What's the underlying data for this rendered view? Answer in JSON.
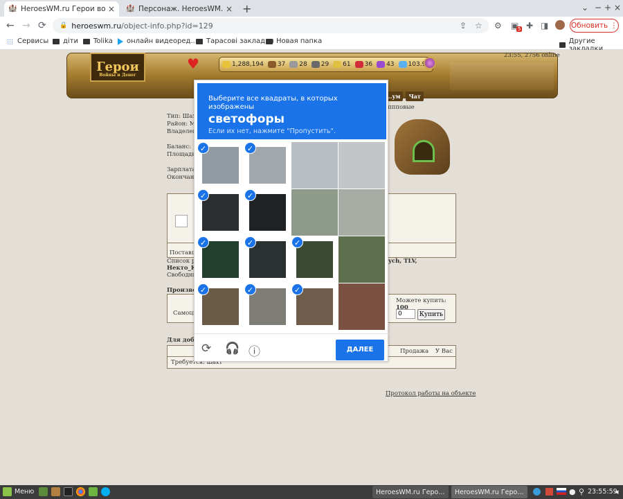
{
  "browser": {
    "tabs": [
      {
        "title": "HeroesWM.ru Герои войны и ...",
        "active": true
      },
      {
        "title": "Персонаж. HeroesWM.ru Геро",
        "active": false
      }
    ],
    "new_tab": "+",
    "url_host": "heroeswm.ru",
    "url_path": "/object-info.php?id=129",
    "update_label": "Обновить",
    "ext_badge": "5",
    "win_controls": [
      "⌄",
      "−",
      "+",
      "×"
    ]
  },
  "bookmarks": {
    "items": [
      "Сервисы",
      "діти",
      "Tolika",
      "онлайн видеоред...",
      "Тарасові закладки",
      "Новая папка"
    ],
    "other": "Другие закладки"
  },
  "game": {
    "logo": "Герои",
    "logo_sub": "Войны и Денег",
    "clock": "23:55, 2756 online",
    "resources": [
      {
        "value": "1,288,194",
        "color": "#e8c33a"
      },
      {
        "value": "37",
        "color": "#8a5a2a"
      },
      {
        "value": "28",
        "color": "#9a9a9a"
      },
      {
        "value": "29",
        "color": "#6a6a6a"
      },
      {
        "value": "61",
        "color": "#e0c040"
      },
      {
        "value": "36",
        "color": "#d02c3c"
      },
      {
        "value": "43",
        "color": "#9a4ad0"
      },
      {
        "value": "103.9",
        "color": "#5ab0f0"
      }
    ],
    "menu": [
      "...ум",
      "Чат"
    ],
    "menu_extra": "ппповые",
    "info_lines": [
      "Тип: Шахт",
      "Район: Mi",
      "Владелец:",
      "",
      "Баланс:",
      "Площадь:",
      "",
      "Зарплата:",
      "Окончани"
    ],
    "suppliers_label": "Поставщ",
    "list_label": "Список ра",
    "list_names": "ych, TLV,",
    "name_bold": "Некто_К",
    "free_label": "Свободны",
    "production_label": "Производ",
    "self_label": "Самоцв",
    "can_buy_label": "Можете купить:",
    "can_buy_value": "100",
    "qty_value": "0",
    "buy_label": "Купить",
    "forgood_label": "Для добы",
    "sale_label": "Продажа",
    "have_label": "У Вас",
    "requires_label": "Требуется: шахт",
    "protocol_label": "Протокол работы на объекте"
  },
  "captcha": {
    "instruction": "Выберите все квадраты, в которых изображены",
    "target": "светофоры",
    "hint": "Если их нет, нажмите \"Пропустить\".",
    "next_label": "ДАЛЕЕ",
    "check_glyph": "✓",
    "tiles": [
      {
        "selected": true,
        "color": "#8f9aa3"
      },
      {
        "selected": true,
        "color": "#a0a8ad"
      },
      {
        "selected": false,
        "color": "#b9bec2"
      },
      {
        "selected": false,
        "color": "#c2c6c8"
      },
      {
        "selected": true,
        "color": "#2a2e30"
      },
      {
        "selected": true,
        "color": "#1e2224"
      },
      {
        "selected": false,
        "color": "#8e9a8a"
      },
      {
        "selected": false,
        "color": "#a7ada4"
      },
      {
        "selected": true,
        "color": "#203f2c"
      },
      {
        "selected": true,
        "color": "#2b3130"
      },
      {
        "selected": true,
        "color": "#3a4a33"
      },
      {
        "selected": false,
        "color": "#5d6f4c"
      },
      {
        "selected": true,
        "color": "#6b5a45"
      },
      {
        "selected": true,
        "color": "#7e7e76"
      },
      {
        "selected": true,
        "color": "#6f5c4a"
      },
      {
        "selected": false,
        "color": "#7a5040"
      }
    ]
  },
  "taskbar": {
    "menu_label": "Меню",
    "windows": [
      "HeroesWM.ru Геро...",
      "HeroesWM.ru Геро..."
    ],
    "clock": "23:55:59"
  }
}
